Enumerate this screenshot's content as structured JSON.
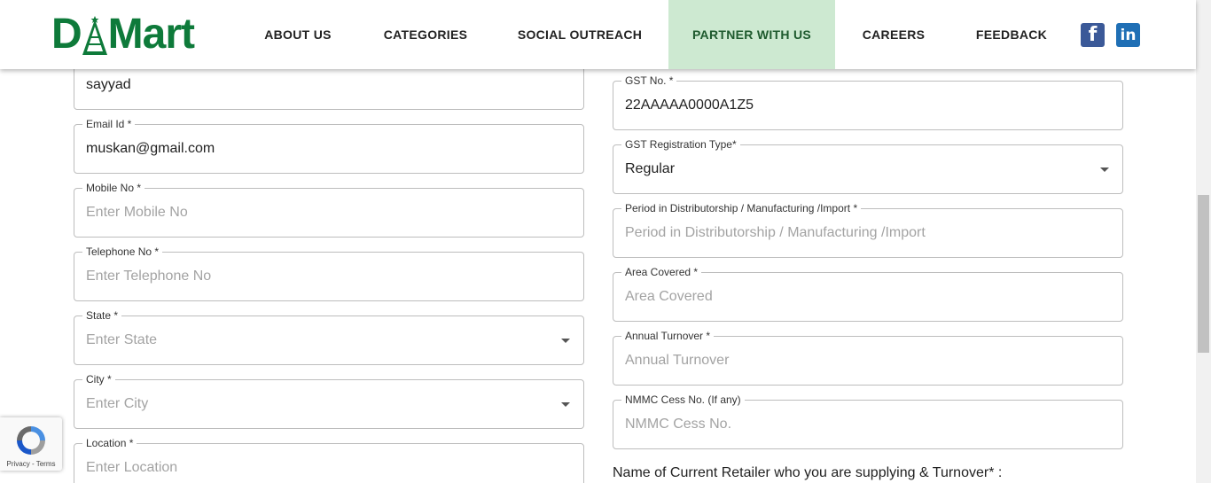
{
  "brand": {
    "name_left": "D",
    "name_right": "Mart",
    "color": "#0e7a3a"
  },
  "nav": {
    "items": [
      {
        "label": "ABOUT US"
      },
      {
        "label": "CATEGORIES"
      },
      {
        "label": "SOCIAL OUTREACH"
      },
      {
        "label": "PARTNER WITH US",
        "active": true
      },
      {
        "label": "CAREERS"
      },
      {
        "label": "FEEDBACK"
      }
    ],
    "active_bg": "#cde9d1"
  },
  "social": {
    "facebook_glyph": "f",
    "linkedin_glyph": "in"
  },
  "form_left": {
    "name_field": {
      "value": "sayyad"
    },
    "email": {
      "label": "Email Id *",
      "value": "muskan@gmail.com"
    },
    "mobile": {
      "label": "Mobile No *",
      "placeholder": "Enter Mobile No"
    },
    "telephone": {
      "label": "Telephone No *",
      "placeholder": "Enter Telephone No"
    },
    "state": {
      "label": "State *",
      "placeholder": "Enter State"
    },
    "city": {
      "label": "City *",
      "placeholder": "Enter City"
    },
    "location": {
      "label": "Location *",
      "placeholder": "Enter Location"
    }
  },
  "form_right": {
    "gst_no": {
      "label": "GST No. *",
      "value": "22AAAAA0000A1Z5"
    },
    "gst_type": {
      "label": "GST Registration Type*",
      "value": "Regular"
    },
    "period": {
      "label": "Period in Distributorship / Manufacturing /Import *",
      "placeholder": "Period in Distributorship / Manufacturing /Import"
    },
    "area": {
      "label": "Area Covered *",
      "placeholder": "Area Covered"
    },
    "turnover": {
      "label": "Annual Turnover *",
      "placeholder": "Annual Turnover"
    },
    "nmmc": {
      "label": "NMMC Cess No. (If any)",
      "placeholder": "NMMC Cess No."
    },
    "retailer_heading": "Name of Current Retailer who you are supplying & Turnover* :"
  },
  "recaptcha": {
    "links": "Privacy - Terms"
  }
}
